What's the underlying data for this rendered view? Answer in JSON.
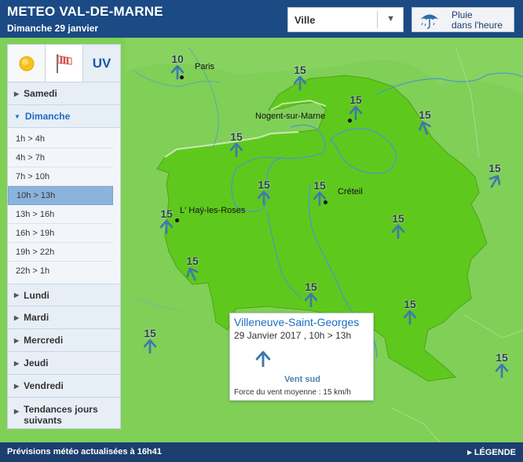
{
  "header": {
    "title": "METEO VAL-DE-MARNE",
    "date": "Dimanche 29 janvier",
    "city_select": "Ville",
    "rain_button_line1": "Pluie",
    "rain_button_line2": "dans l'heure"
  },
  "sidebar": {
    "tabs": {
      "sun_icon": "sun-icon",
      "wind_icon": "windsock-icon",
      "uv": "UV"
    },
    "days": [
      {
        "label": "Samedi",
        "expanded": false
      },
      {
        "label": "Dimanche",
        "expanded": true
      },
      {
        "label": "Lundi",
        "expanded": false
      },
      {
        "label": "Mardi",
        "expanded": false
      },
      {
        "label": "Mercredi",
        "expanded": false
      },
      {
        "label": "Jeudi",
        "expanded": false
      },
      {
        "label": "Vendredi",
        "expanded": false
      },
      {
        "label": "Tendances jours",
        "label2": "suivants",
        "expanded": false
      }
    ],
    "slots": [
      "1h > 4h",
      "4h > 7h",
      "7h > 10h",
      "10h > 13h",
      "13h > 16h",
      "16h > 19h",
      "19h > 22h",
      "22h > 1h"
    ],
    "active_slot": "10h > 13h"
  },
  "map": {
    "places": [
      "Paris",
      "Nogent-sur-Marne",
      "Créteil",
      "L' Haÿ-les-Roses"
    ],
    "wind_values": [
      "10",
      "15",
      "15",
      "15",
      "15",
      "15",
      "15",
      "15",
      "15",
      "15",
      "15",
      "15",
      "15",
      "15",
      "15",
      "15"
    ],
    "arrow_color": "#3f78ae",
    "region_color": "#5fc81d"
  },
  "popup": {
    "city": "Villeneuve-Saint-Georges",
    "date": "29 Janvier 2017 , 10h > 13h",
    "direction": "Vent sud",
    "force": "Force du vent moyenne : 15 km/h"
  },
  "footer": {
    "updated": "Prévisions météo actualisées à 16h41",
    "legend": "LÉGENDE"
  }
}
